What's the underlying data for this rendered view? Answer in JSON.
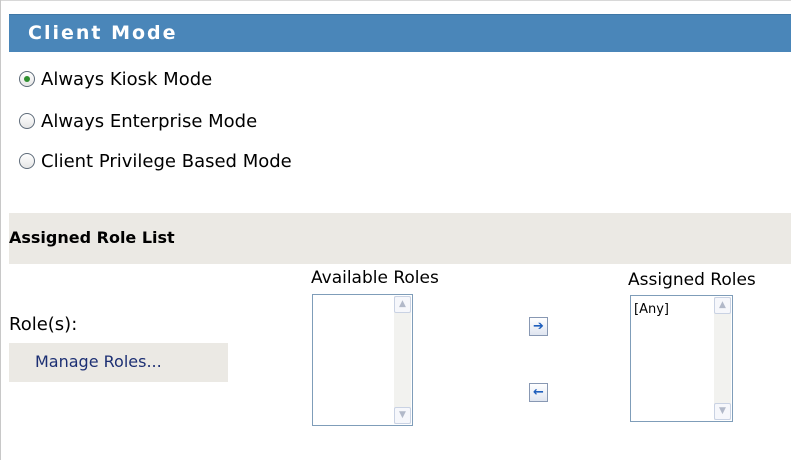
{
  "client_mode": {
    "title": "Client Mode",
    "options": [
      {
        "label": "Always Kiosk Mode",
        "selected": true
      },
      {
        "label": "Always Enterprise Mode",
        "selected": false
      },
      {
        "label": "Client Privilege Based Mode",
        "selected": false
      }
    ]
  },
  "assigned_role_list": {
    "title": "Assigned Role List",
    "roles_label": "Role(s):",
    "manage_roles_label": "Manage Roles...",
    "available": {
      "caption": "Available Roles",
      "items": []
    },
    "assigned": {
      "caption": "Assigned Roles",
      "items": [
        "[Any]"
      ]
    },
    "icons": {
      "move_right": "arrow-right-icon",
      "move_left": "arrow-left-icon",
      "scroll_up": "chevron-up-icon",
      "scroll_down": "chevron-down-icon"
    }
  },
  "colors": {
    "header_bg": "#4a86b9",
    "subheader_bg": "#ebe9e4",
    "link": "#1c2f73"
  }
}
